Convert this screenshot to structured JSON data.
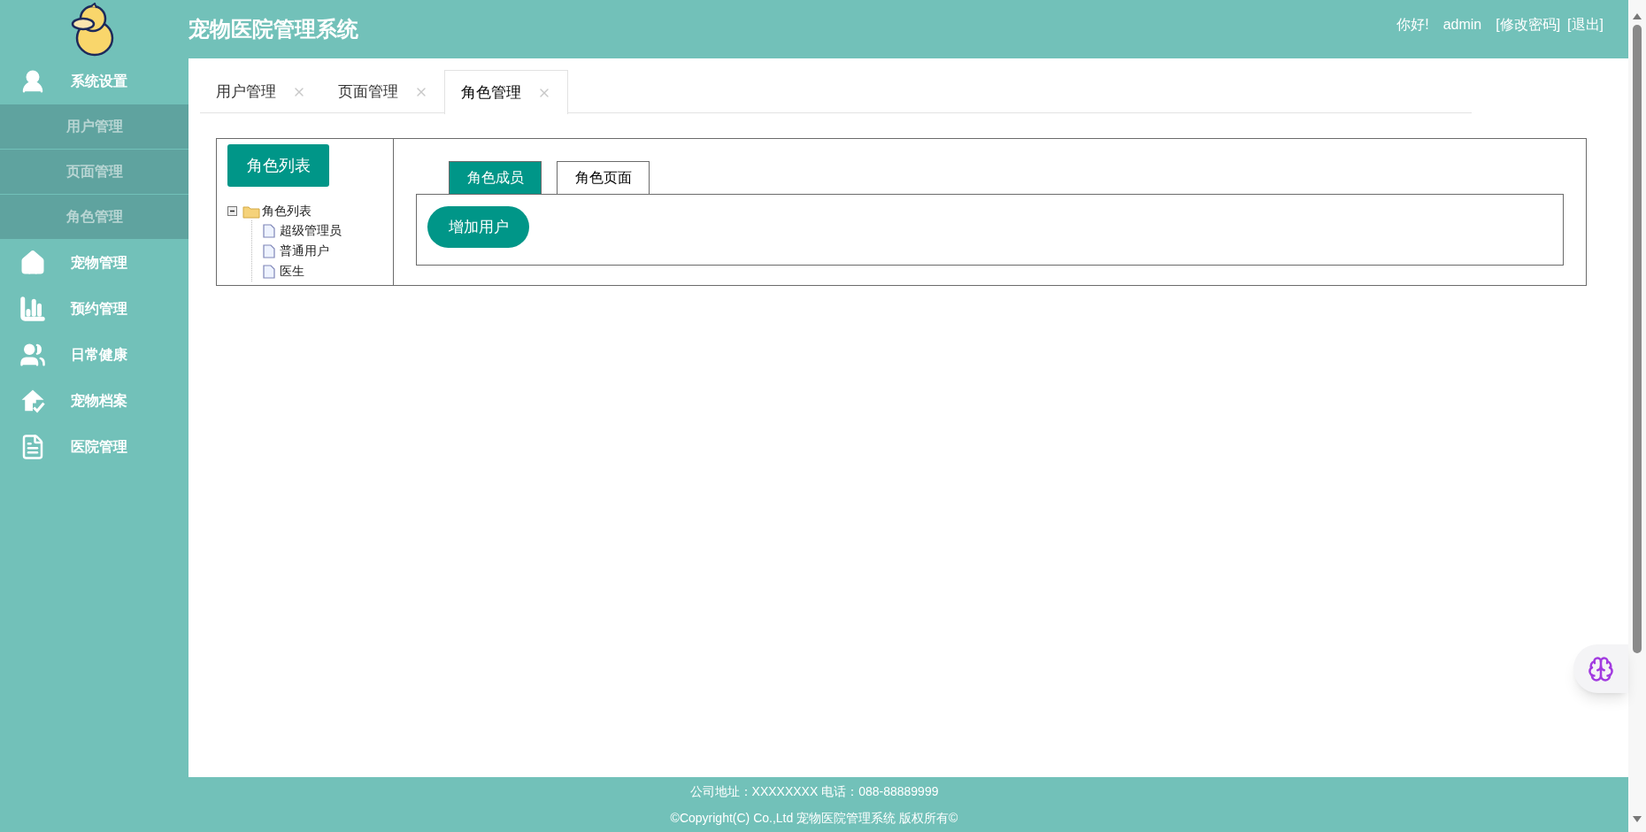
{
  "header": {
    "title": "宠物医院管理系统",
    "greeting": "你好!",
    "user": "admin",
    "links": [
      "[修改密码]",
      "[退出]"
    ]
  },
  "sidebar": {
    "items": [
      {
        "label": "系统设置",
        "children": [
          {
            "label": "用户管理"
          },
          {
            "label": "页面管理"
          },
          {
            "label": "角色管理"
          }
        ]
      },
      {
        "label": "宠物管理"
      },
      {
        "label": "预约管理"
      },
      {
        "label": "日常健康"
      },
      {
        "label": "宠物档案"
      },
      {
        "label": "医院管理"
      }
    ]
  },
  "tabs": [
    {
      "label": "用户管理",
      "selected": false
    },
    {
      "label": "页面管理",
      "selected": false
    },
    {
      "label": "角色管理",
      "selected": true
    }
  ],
  "role_panel": {
    "list_button": "角色列表",
    "tree": {
      "label": "角色列表",
      "expanded": true,
      "children": [
        {
          "label": "超级管理员"
        },
        {
          "label": "普通用户"
        },
        {
          "label": "医生"
        }
      ]
    },
    "subtabs": [
      {
        "label": "角色成员",
        "selected": true
      },
      {
        "label": "角色页面",
        "selected": false
      }
    ],
    "add_button": "增加用户"
  },
  "footer": [
    "公司地址：XXXXXXXX 电话：088-88889999",
    "©Copyright(C) Co.,Ltd 宠物医院管理系统 版权所有©"
  ]
}
